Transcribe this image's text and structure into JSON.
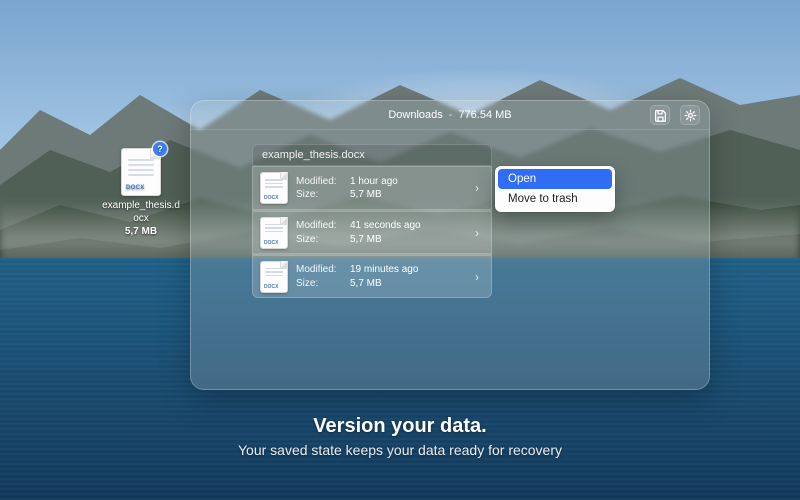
{
  "desktop_file": {
    "name": "example_thesis.docx",
    "size": "5,7 MB",
    "ext": "DOCX",
    "badge": "?"
  },
  "panel": {
    "title_folder": "Downloads",
    "title_sep": "-",
    "title_size": "776.54 MB"
  },
  "versions": {
    "filename": "example_thesis.docx",
    "label_modified": "Modified:",
    "label_size": "Size:",
    "ext": "DOCX",
    "items": [
      {
        "modified": "1 hour ago",
        "size": "5,7 MB"
      },
      {
        "modified": "41 seconds ago",
        "size": "5,7 MB"
      },
      {
        "modified": "19 minutes ago",
        "size": "5,7 MB"
      }
    ]
  },
  "context_menu": {
    "open": "Open",
    "trash": "Move to trash"
  },
  "tagline": {
    "headline": "Version your data.",
    "sub": "Your saved state keeps your data ready for recovery"
  }
}
